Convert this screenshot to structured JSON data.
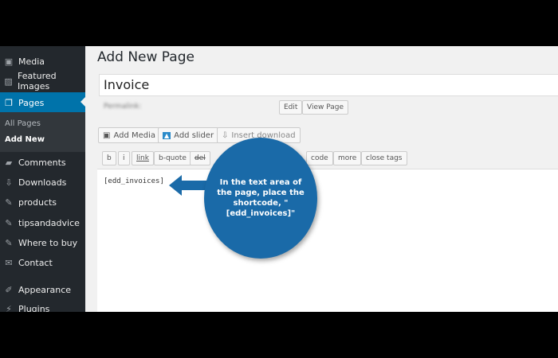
{
  "sidebar": {
    "items": [
      "Media",
      "Featured Images",
      "Pages",
      "Comments",
      "Downloads",
      "products",
      "tipsandadvice",
      "Where to buy",
      "Contact",
      "Appearance",
      "Plugins"
    ],
    "sub": [
      "All Pages",
      "Add New"
    ]
  },
  "page": {
    "title": "Add New Page",
    "post_title": "Invoice",
    "permalink_label": "Permalink:",
    "edit": "Edit",
    "view": "View Page"
  },
  "media": {
    "add_media": "Add Media",
    "add_slider": "Add slider",
    "insert_download": "Insert download"
  },
  "quicktags": [
    "b",
    "i",
    "link",
    "b-quote",
    "del",
    "code",
    "more",
    "close tags"
  ],
  "editor": {
    "content": "[edd_invoices]"
  },
  "callout": {
    "text": "In the text area of the page, place the shortcode, \"[edd_invoices]\"",
    "color": "#1a6aa8"
  }
}
